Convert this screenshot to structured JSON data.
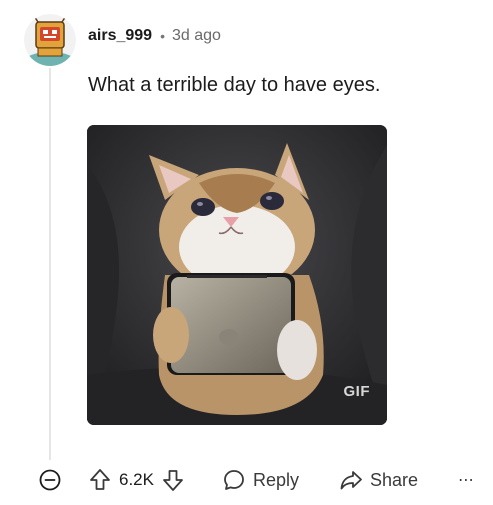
{
  "comment": {
    "username": "airs_999",
    "separator": "•",
    "time_ago": "3d ago",
    "text": "What a terrible day to have eyes.",
    "media": {
      "type": "gif",
      "badge": "GIF"
    }
  },
  "actions": {
    "collapse_icon": "minus-circle-icon",
    "upvote_icon": "arrow-up-icon",
    "vote_count": "6.2K",
    "downvote_icon": "arrow-down-icon",
    "reply_label": "Reply",
    "reply_icon": "speech-bubble-icon",
    "share_label": "Share",
    "share_icon": "share-arrow-icon",
    "more_label": "⋯"
  },
  "colors": {
    "text": "#1c1c1c",
    "muted": "#6a6a6a",
    "thread_line": "#e6e6e6"
  }
}
